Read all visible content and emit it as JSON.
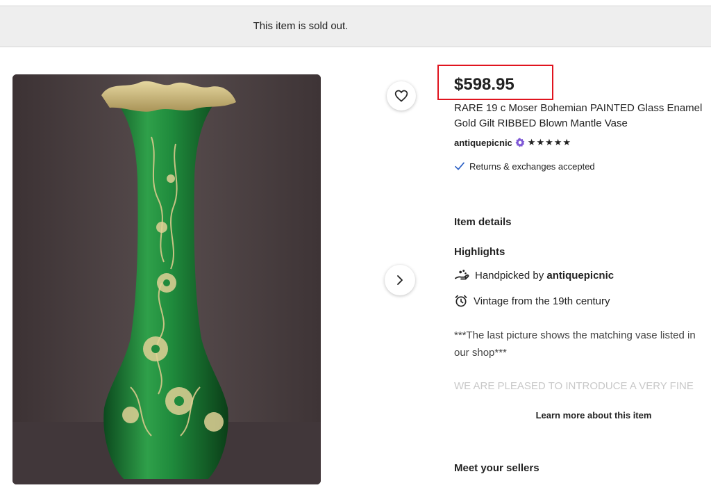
{
  "banner": {
    "text": "This item is sold out."
  },
  "listing": {
    "price": "$598.95",
    "title": "RARE 19 c Moser Bohemian PAINTED Glass Enamel Gold Gilt RIBBED Blown Mantle Vase",
    "shop_name": "antiquepicnic",
    "rating_stars": "★★★★★",
    "rating_value": 5,
    "returns": "Returns & exchanges accepted"
  },
  "details": {
    "item_details_label": "Item details",
    "highlights_label": "Highlights",
    "handpicked_prefix": "Handpicked by",
    "handpicked_shop": "antiquepicnic",
    "vintage": "Vintage from the 19th century",
    "description_line1": "***The last picture shows the matching vase listed in",
    "description_line2": "our shop***",
    "description_faded": "WE ARE PLEASED TO INTRODUCE A VERY FINE",
    "learn_more": "Learn more about this item",
    "meet_sellers": "Meet your sellers"
  },
  "icons": {
    "favorite": "heart-icon",
    "next": "chevron-right-icon",
    "star_seller": "star-seller-badge-icon",
    "check": "checkmark-icon",
    "hand": "hand-icon",
    "clock": "alarm-clock-icon"
  },
  "colors": {
    "price_highlight_border": "#e0141e",
    "banner_bg": "#eeeeee",
    "star_seller_purple": "#7f59d6",
    "check_blue": "#2a5fc4",
    "vase_green": "#1f8a3c",
    "photo_bg": "#4a4142"
  }
}
